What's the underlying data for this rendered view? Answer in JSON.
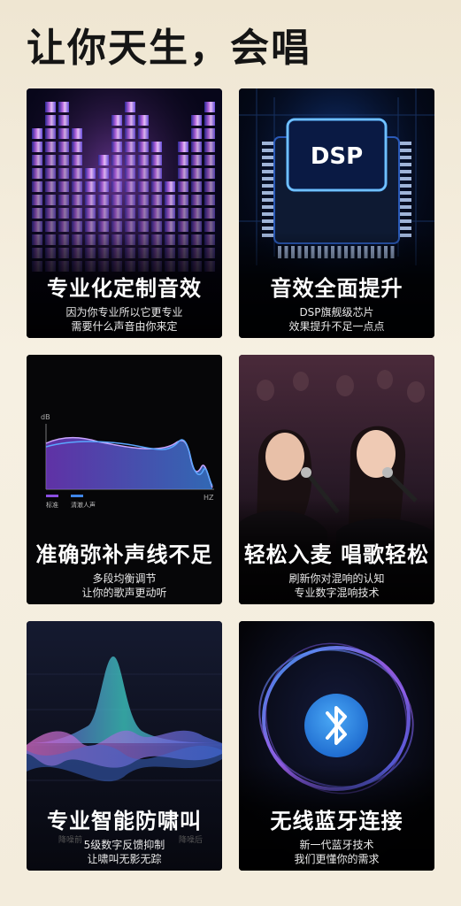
{
  "title": "让你天生，会唱",
  "cards": [
    {
      "title": "专业化定制音效",
      "line1": "因为你专业所以它更专业",
      "line2": "需要什么声音由你来定"
    },
    {
      "title": "音效全面提升",
      "line1": "DSP旗舰级芯片",
      "line2": "效果提升不足一点点",
      "chip_label": "DSP"
    },
    {
      "title": "准确弥补声线不足",
      "line1": "多段均衡调节",
      "line2": "让你的歌声更动听",
      "eq_chart": {
        "y_unit": "dB",
        "x_unit": "HZ",
        "legend": [
          "标准",
          "清澈人声"
        ]
      }
    },
    {
      "title": "轻松入麦 唱歌轻松",
      "line1": "刷新你对混响的认知",
      "line2": "专业数字混响技术"
    },
    {
      "title": "专业智能防啸叫",
      "line1": "5级数字反馈抑制",
      "line2": "让啸叫无影无踪",
      "ghost_labels": [
        "降噪前",
        "降噪后"
      ]
    },
    {
      "title": "无线蓝牙连接",
      "line1": "新一代蓝牙技术",
      "line2": "我们更懂你的需求"
    }
  ],
  "colors": {
    "accent_purple": "#7b3fd6",
    "accent_blue": "#3f86e8",
    "bluetooth": "#2f8ee8"
  },
  "icons": [
    "dsp-chip-icon",
    "bluetooth-icon"
  ]
}
